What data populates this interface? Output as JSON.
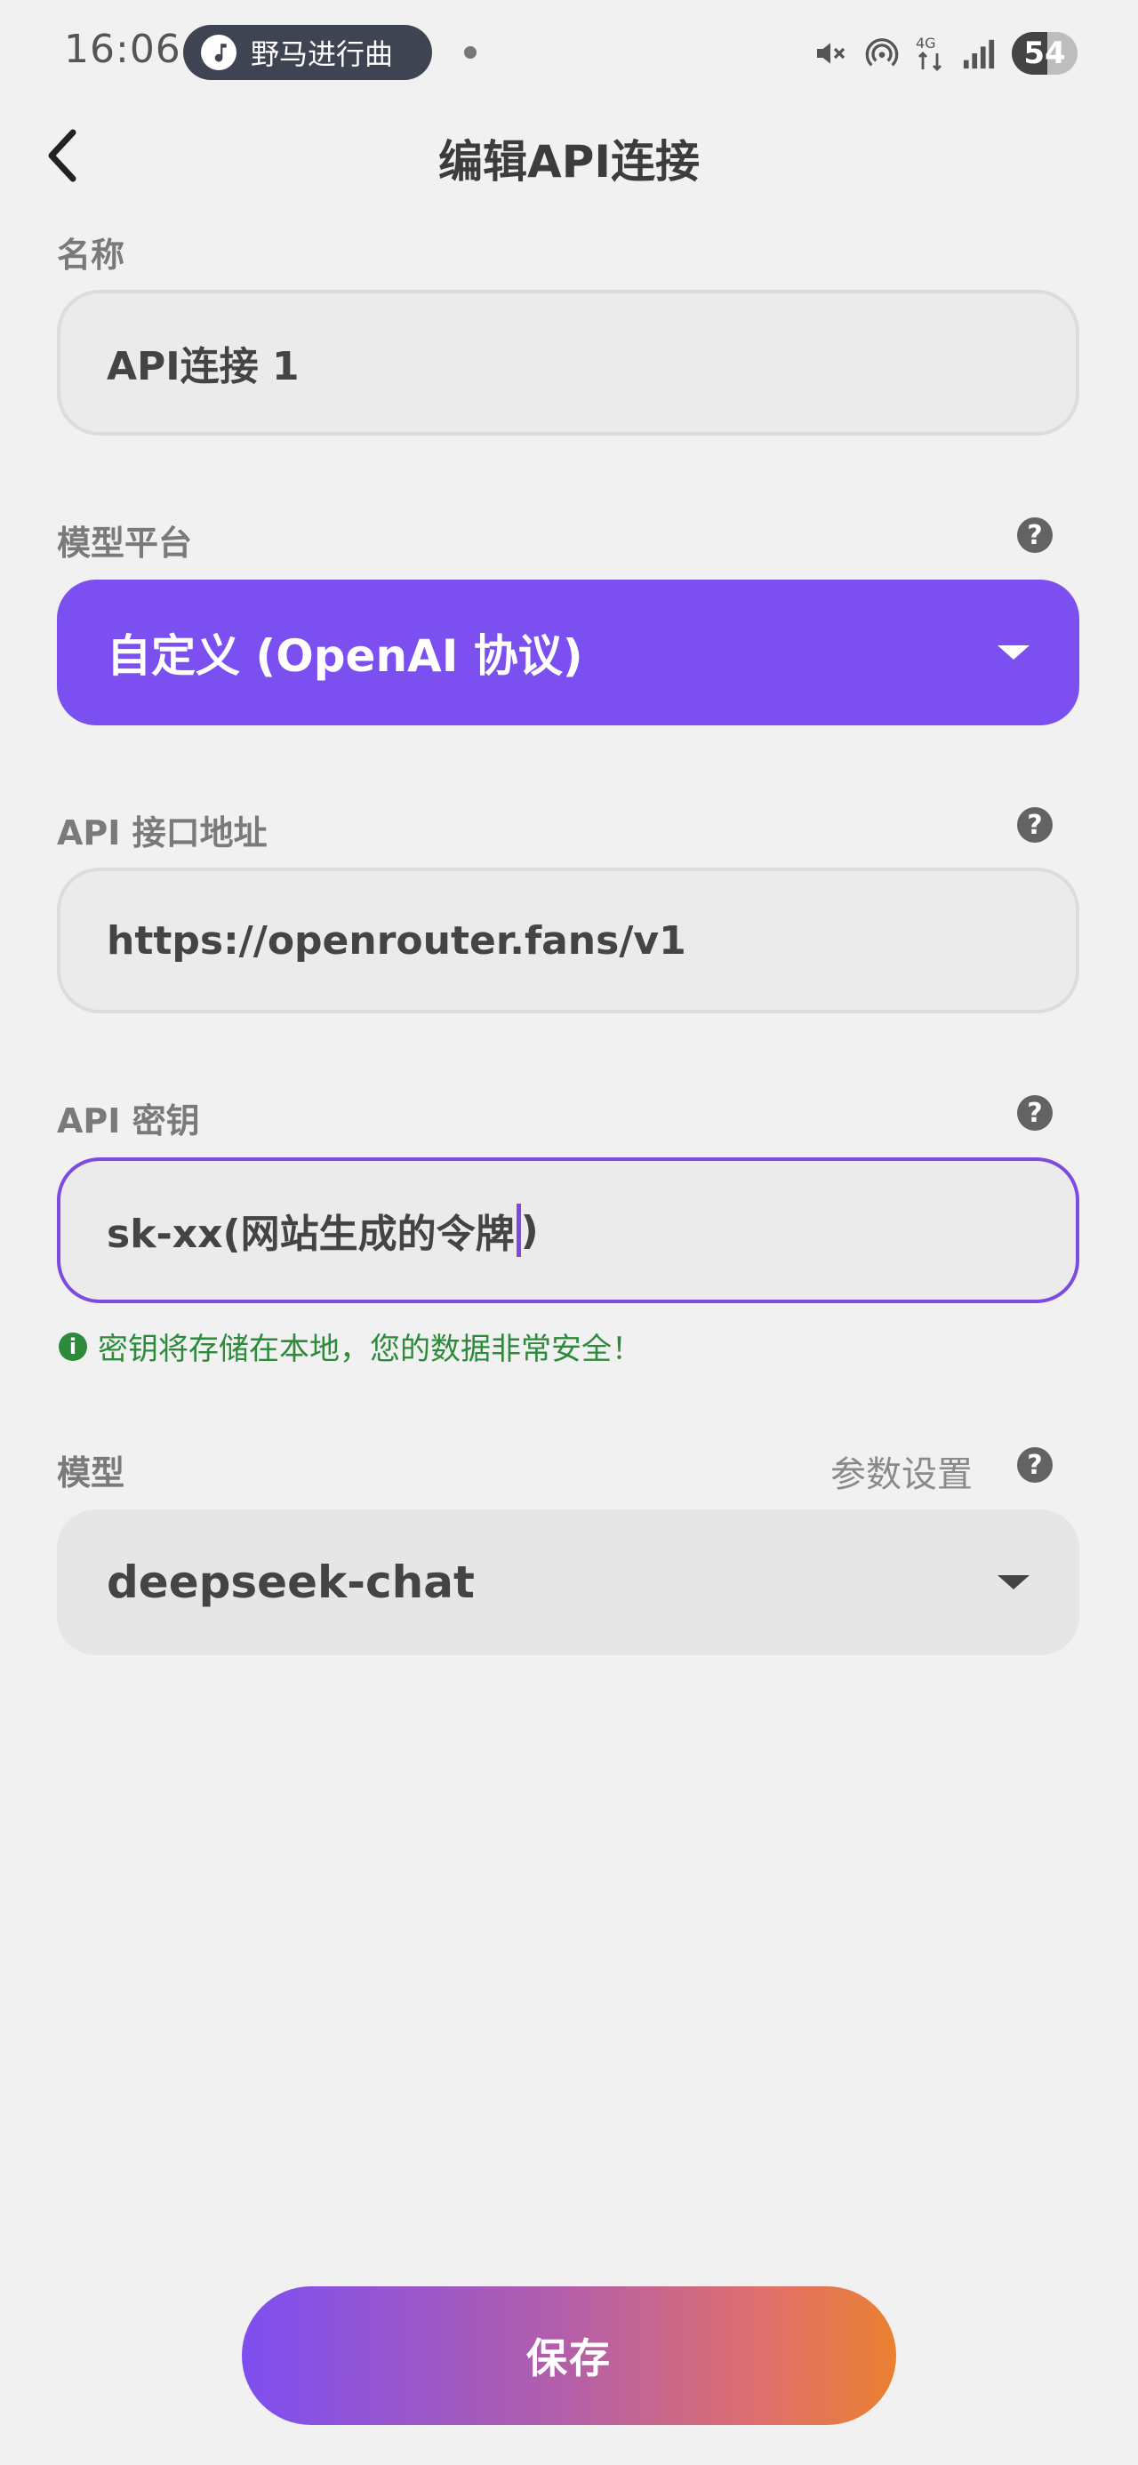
{
  "status_bar": {
    "time": "16:06",
    "media_title": "野马进行曲",
    "network": "4G",
    "battery": "54",
    "icons": [
      "music-note-icon",
      "mute-icon",
      "hotspot-icon",
      "network-4g-icon",
      "signal-icon",
      "battery-icon"
    ]
  },
  "header": {
    "title": "编辑API连接",
    "back_icon": "chevron-left-icon"
  },
  "form": {
    "name": {
      "label": "名称",
      "value": "API连接 1"
    },
    "platform": {
      "label": "模型平台",
      "value": "自定义 (OpenAI 协议)"
    },
    "api_url": {
      "label": "API 接口地址",
      "value": "https://openrouter.fans/v1"
    },
    "api_key": {
      "label": "API 密钥",
      "value": "sk-xx(网站生成的令牌",
      "value_tail": ")",
      "hint": "密钥将存储在本地，您的数据非常安全！"
    },
    "model": {
      "label": "模型",
      "params_label": "参数设置",
      "value": "deepseek-chat"
    },
    "help_glyph": "?",
    "hint_glyph": "i"
  },
  "save_label": "保存",
  "colors": {
    "accent": "#7c4ff0",
    "background": "#f1f1f1",
    "success": "#2d8a3a",
    "save_gradient_start": "#7d4ef0",
    "save_gradient_end": "#ea8030"
  }
}
